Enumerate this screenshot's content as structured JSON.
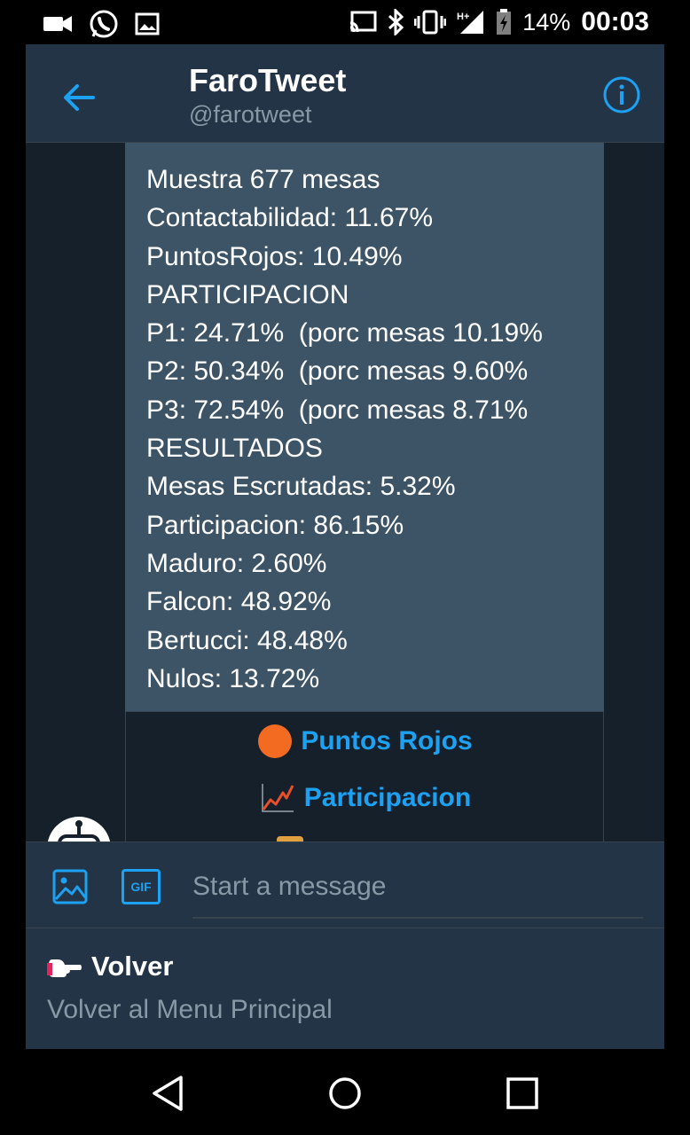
{
  "status_bar": {
    "battery": "14%",
    "time": "00:03"
  },
  "header": {
    "title": "FaroTweet",
    "handle": "@farotweet"
  },
  "message": {
    "lines": [
      "Muestra 677 mesas",
      "Contactabilidad: 11.67%",
      "PuntosRojos: 10.49%",
      "PARTICIPACION",
      "P1: 24.71%  (porc mesas 10.19%",
      "P2: 50.34%  (porc mesas 9.60%",
      "P3: 72.54%  (porc mesas 8.71%",
      "RESULTADOS",
      "Mesas Escrutadas: 5.32%",
      "Participacion: 86.15%",
      "Maduro: 2.60%",
      "Falcon: 48.92%",
      "Bertucci: 48.48%",
      "Nulos: 13.72%"
    ]
  },
  "quick_replies": [
    {
      "label": "Puntos Rojos",
      "icon": "orange-circle-icon"
    },
    {
      "label": "Participacion",
      "icon": "chart-line-icon"
    }
  ],
  "composer": {
    "placeholder": "Start a message",
    "gif_label": "GIF"
  },
  "menu_option": {
    "title": "Volver",
    "subtitle": "Volver al Menu Principal",
    "icon": "pointing-hand-icon"
  },
  "colors": {
    "accent": "#1da1f2",
    "header_bg": "#243447",
    "bubble_bg": "#3d5466",
    "convo_bg": "#15202b"
  }
}
